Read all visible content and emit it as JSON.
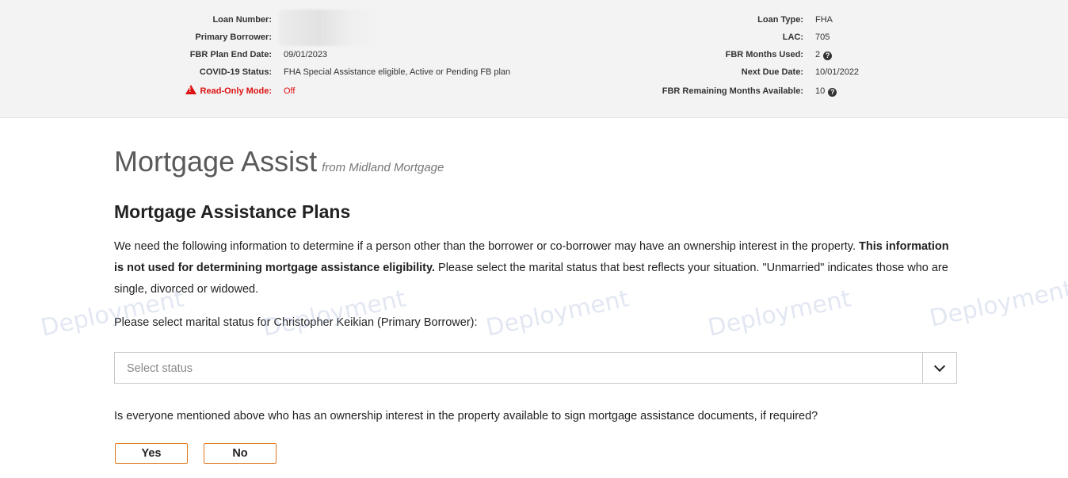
{
  "header": {
    "left": [
      {
        "label": "Loan Number:",
        "value": ""
      },
      {
        "label": "Primary Borrower:",
        "value": ""
      },
      {
        "label": "FBR Plan End Date:",
        "value": "09/01/2023"
      },
      {
        "label": "COVID-19 Status:",
        "value": "FHA Special Assistance eligible, Active or Pending FB plan"
      },
      {
        "label": "Read-Only Mode:",
        "value": "Off"
      }
    ],
    "right": [
      {
        "label": "Loan Type:",
        "value": "FHA"
      },
      {
        "label": "LAC:",
        "value": "705"
      },
      {
        "label": "FBR Months Used:",
        "value": "2"
      },
      {
        "label": "Next Due Date:",
        "value": "10/01/2022"
      },
      {
        "label": "FBR Remaining Months Available:",
        "value": "10"
      }
    ]
  },
  "app": {
    "title": "Mortgage Assist",
    "subtitle": "from Midland Mortgage"
  },
  "section": {
    "title": "Mortgage Assistance Plans",
    "para_part1": "We need the following information to determine if a person other than the borrower or co-borrower may have an ownership interest in the property. ",
    "para_bold": "This information is not used for determining mortgage assistance eligibility.",
    "para_part2": " Please select the marital status that best reflects your situation. \"Unmarried\" indicates those who are single, divorced or widowed.",
    "prompt": "Please select marital status for Christopher Keikian (Primary Borrower):",
    "select_placeholder": "Select status",
    "question": "Is everyone mentioned above who has an ownership interest in the property available to sign mortgage assistance documents, if required?",
    "yes_label": "Yes",
    "no_label": "No"
  },
  "watermark": "Deployment",
  "colors": {
    "accent_orange": "#e07820",
    "warning_red": "#d11111",
    "header_bg": "#f3f3f3"
  }
}
